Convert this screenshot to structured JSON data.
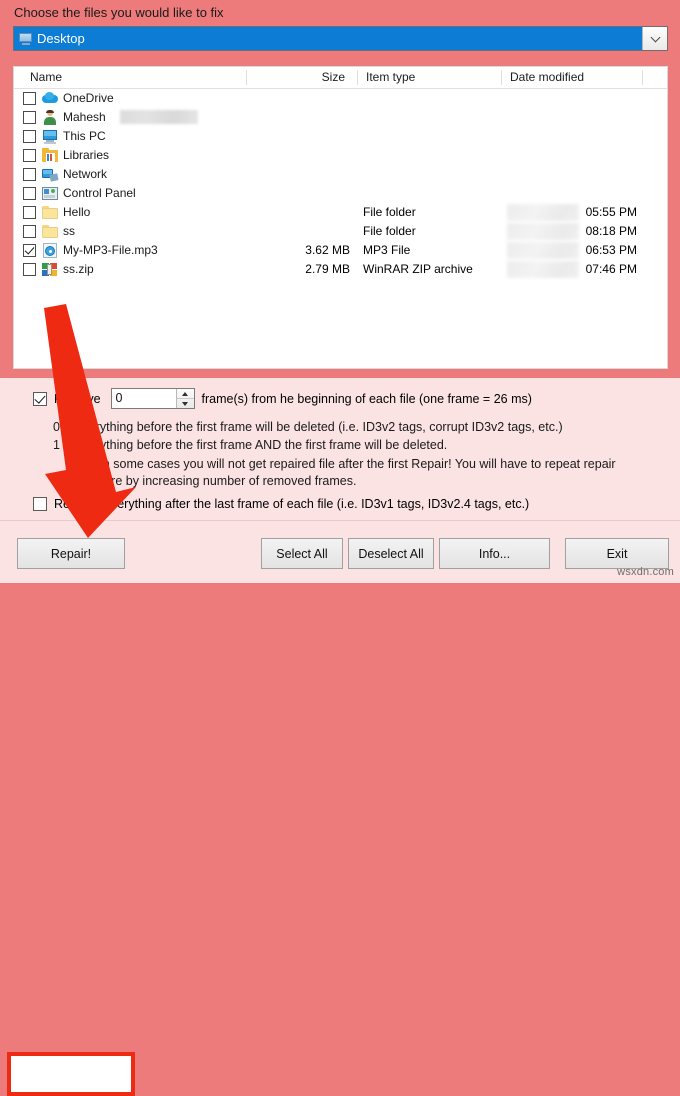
{
  "window": {
    "prompt_label": "Choose the files you would like to fix"
  },
  "path_combo": {
    "icon": "desktop-icon",
    "value": "Desktop",
    "dropdown_icon": "chevron-down-icon"
  },
  "file_list": {
    "columns": [
      {
        "key": "name",
        "label": "Name"
      },
      {
        "key": "size",
        "label": "Size"
      },
      {
        "key": "type",
        "label": "Item type"
      },
      {
        "key": "date",
        "label": "Date modified"
      }
    ],
    "rows": [
      {
        "checked": false,
        "icon": "onedrive-icon",
        "name": "OneDrive",
        "redacted_name": false,
        "size": "",
        "type": "",
        "date": "",
        "date_redacted": false
      },
      {
        "checked": false,
        "icon": "user-icon",
        "name": "Mahesh",
        "redacted_name": true,
        "size": "",
        "type": "",
        "date": "",
        "date_redacted": false
      },
      {
        "checked": false,
        "icon": "this-pc-icon",
        "name": "This PC",
        "redacted_name": false,
        "size": "",
        "type": "",
        "date": "",
        "date_redacted": false
      },
      {
        "checked": false,
        "icon": "libraries-icon",
        "name": "Libraries",
        "redacted_name": false,
        "size": "",
        "type": "",
        "date": "",
        "date_redacted": false
      },
      {
        "checked": false,
        "icon": "network-icon",
        "name": "Network",
        "redacted_name": false,
        "size": "",
        "type": "",
        "date": "",
        "date_redacted": false
      },
      {
        "checked": false,
        "icon": "control-panel-icon",
        "name": "Control Panel",
        "redacted_name": false,
        "size": "",
        "type": "",
        "date": "",
        "date_redacted": false
      },
      {
        "checked": false,
        "icon": "folder-icon",
        "name": "Hello",
        "redacted_name": false,
        "size": "",
        "type": "File folder",
        "date": "05:55 PM",
        "date_redacted": true
      },
      {
        "checked": false,
        "icon": "folder-icon",
        "name": "ss",
        "redacted_name": false,
        "size": "",
        "type": "File folder",
        "date": "08:18 PM",
        "date_redacted": true
      },
      {
        "checked": true,
        "icon": "mp3-file-icon",
        "name": "My-MP3-File.mp3",
        "redacted_name": false,
        "size": "3.62 MB",
        "type": "MP3 File",
        "date": "06:53 PM",
        "date_redacted": true
      },
      {
        "checked": false,
        "icon": "zip-archive-icon",
        "name": "ss.zip",
        "redacted_name": false,
        "size": "2.79 MB",
        "type": "WinRAR ZIP archive",
        "date": "07:46 PM",
        "date_redacted": true
      }
    ]
  },
  "options": {
    "remove_frames": {
      "checked": true,
      "label": "Remove",
      "value": "0",
      "suffix": "frame(s) from he beginning of each file (one frame = 26 ms)"
    },
    "hints": [
      "0 = Everything before the first frame will be deleted (i.e. ID3v2 tags, corrupt ID3v2 tags, etc.)",
      "1 = Everything before the first frame AND the first frame will be deleted.",
      "Note:  In some cases you will not get repaired file after the first Repair! You will have to repeat repair procedure by increasing number of removed frames."
    ],
    "remove_after_last": {
      "checked": false,
      "label": "Remove everything after the last frame of each file (i.e. ID3v1 tags, ID3v2.4 tags, etc.)"
    }
  },
  "buttons": {
    "repair": "Repair!",
    "select_all": "Select All",
    "deselect_all": "Deselect All",
    "info": "Info...",
    "exit": "Exit"
  },
  "annotations": {
    "arrow": "red-down-arrow",
    "highlight_target": "repair-button"
  },
  "watermark": "wsxdn.com",
  "colors": {
    "page_background": "#ee7b7b",
    "panel_background": "#fbe3e4",
    "combo_selection": "#0c7cd5",
    "annotation_red": "#ee2a12"
  }
}
